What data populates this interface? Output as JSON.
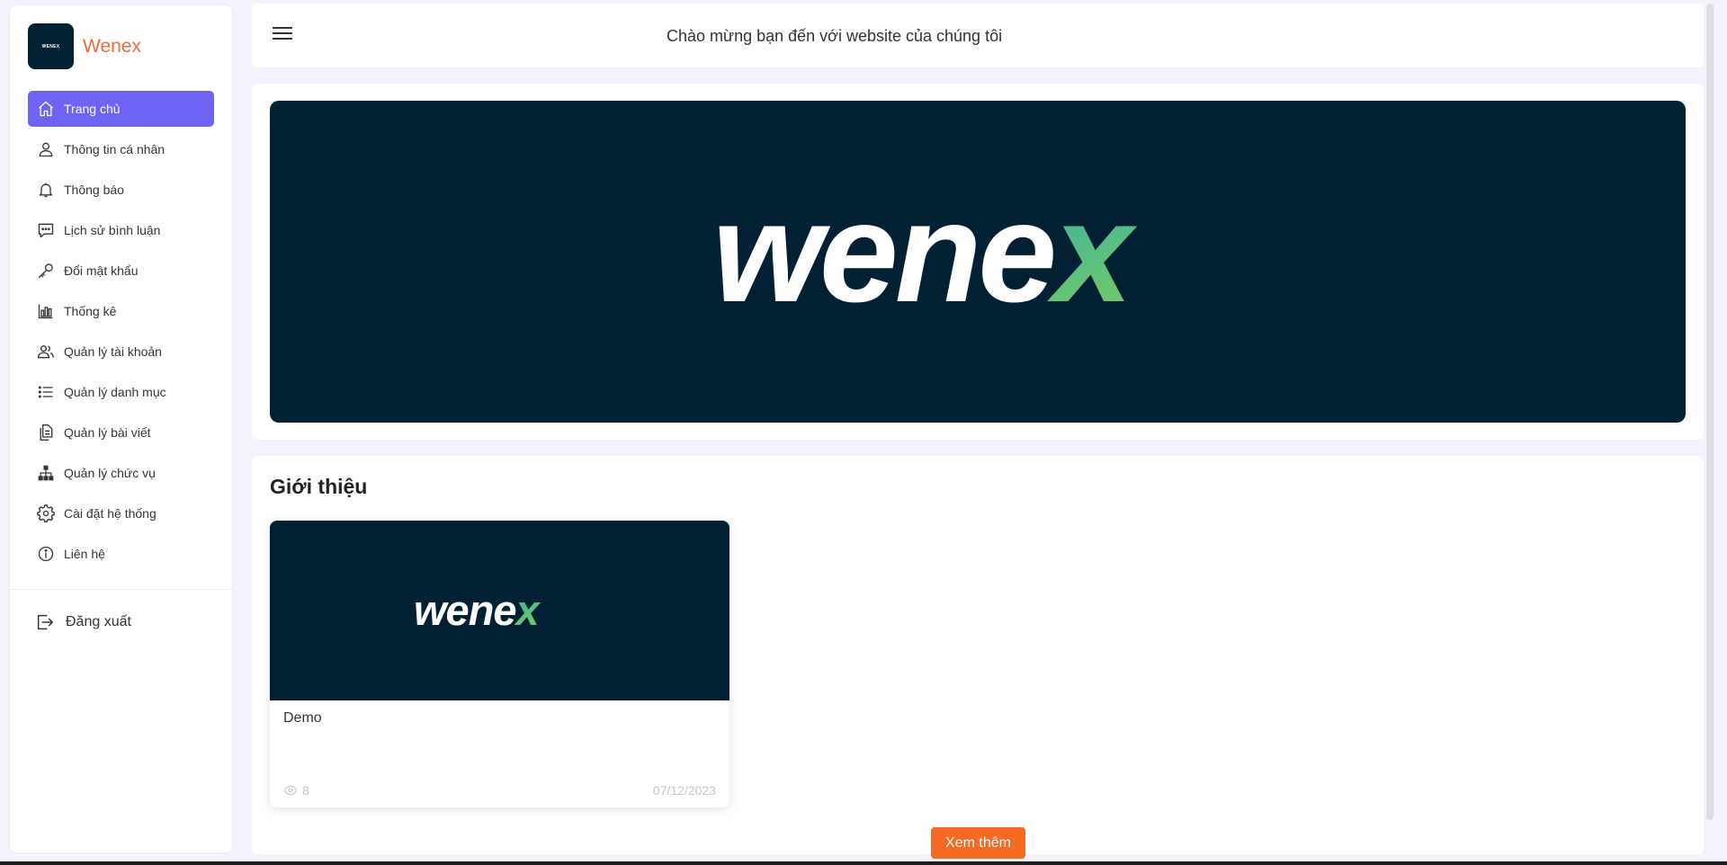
{
  "brand": {
    "logo_text": "WENEX",
    "name": "Wenex"
  },
  "sidebar": {
    "items": [
      {
        "label": "Trang chủ",
        "icon": "home-icon",
        "active": true
      },
      {
        "label": "Thông tin cá nhân",
        "icon": "user-icon"
      },
      {
        "label": "Thông báo",
        "icon": "bell-icon"
      },
      {
        "label": "Lịch sử bình luận",
        "icon": "comment-icon"
      },
      {
        "label": "Đổi mật khẩu",
        "icon": "key-icon"
      },
      {
        "label": "Thống kê",
        "icon": "bar-chart-icon"
      },
      {
        "label": "Quản lý tài khoản",
        "icon": "users-icon"
      },
      {
        "label": "Quản lý danh mục",
        "icon": "list-icon"
      },
      {
        "label": "Quản lý bài viết",
        "icon": "document-icon"
      },
      {
        "label": "Quản lý chức vụ",
        "icon": "org-chart-icon"
      },
      {
        "label": "Cài đặt hệ thống",
        "icon": "gear-icon"
      },
      {
        "label": "Liên hệ",
        "icon": "info-icon"
      }
    ],
    "logout_label": "Đăng xuất"
  },
  "header": {
    "welcome": "Chào mừng bạn đến với website của chúng tôi"
  },
  "banner": {
    "logo_text": "wenex"
  },
  "intro": {
    "title": "Giới thiệu",
    "posts": [
      {
        "thumb_text": "wenex",
        "title": "Demo",
        "views": "8",
        "date": "07/12/2023"
      }
    ],
    "more_label": "Xem thêm"
  },
  "colors": {
    "accent": "#6f63f4",
    "brand_orange": "#ee6a3f",
    "button_orange": "#f56a23",
    "navy": "#022033",
    "logo_gradient_start": "#0a9bd6",
    "logo_gradient_end": "#7ccd5c"
  }
}
